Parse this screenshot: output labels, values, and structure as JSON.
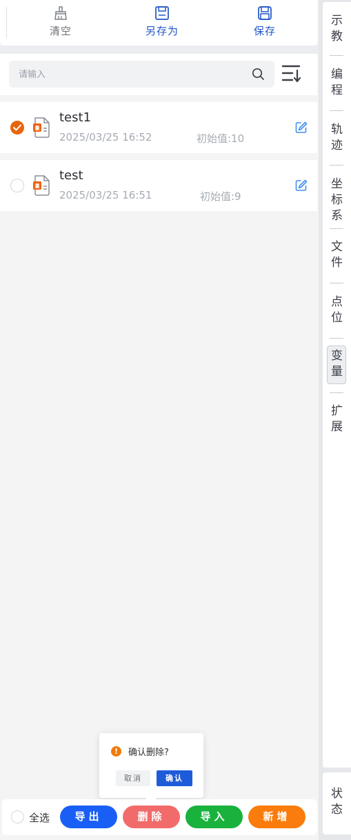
{
  "toolbar": {
    "clear_label": "清空",
    "save_as_label": "另存为",
    "save_label": "保存"
  },
  "search": {
    "placeholder": "请输入"
  },
  "items": [
    {
      "name": "test1",
      "date": "2025/03/25 16:52",
      "init": "初始值:10",
      "checked": true
    },
    {
      "name": "test",
      "date": "2025/03/25 16:51",
      "init": "初始值:9",
      "checked": false
    }
  ],
  "popconfirm": {
    "message": "确认删除?",
    "cancel": "取消",
    "confirm": "确认"
  },
  "bottom": {
    "select_all": "全选",
    "export": "导出",
    "delete": "删除",
    "import": "导入",
    "add": "新增"
  },
  "sidebar": {
    "items": [
      {
        "c1": "示",
        "c2": "教"
      },
      {
        "c1": "编",
        "c2": "程"
      },
      {
        "c1": "轨",
        "c2": "迹"
      },
      {
        "c1": "坐",
        "c2": "标",
        "c3": "系"
      },
      {
        "c1": "文",
        "c2": "件"
      },
      {
        "c1": "点",
        "c2": "位"
      },
      {
        "c1": "变",
        "c2": "量"
      },
      {
        "c1": "扩",
        "c2": "展"
      }
    ],
    "status": {
      "c1": "状",
      "c2": "态"
    }
  },
  "colors": {
    "accent_blue": "#1f55c8",
    "checked_orange": "#e8650c",
    "export_blue": "#1a5ff5",
    "delete_red": "#f26b6b",
    "import_green": "#18b23c",
    "add_orange": "#fa7c0c"
  }
}
